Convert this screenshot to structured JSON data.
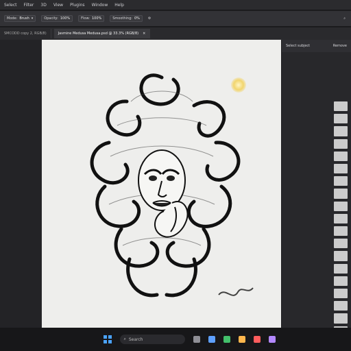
{
  "menu": [
    "Select",
    "Filter",
    "3D",
    "View",
    "Plugins",
    "Window",
    "Help"
  ],
  "options": {
    "mode_label": "Mode:",
    "mode_value": "Brush",
    "opacity_label": "Opacity:",
    "opacity_value": "100%",
    "flow_label": "Flow:",
    "flow_value": "100%",
    "smoothing_label": "Smoothing:",
    "smoothing_value": "0%"
  },
  "tabs": [
    {
      "label": "SMCODD copy 2, RGB/8)"
    },
    {
      "label": "Jasmine Medusa Medusa.psd @ 33.3% (RGB/8)"
    }
  ],
  "panel": {
    "title": "Select subject",
    "button": "Remove"
  },
  "taskbar": {
    "search_placeholder": "Search"
  },
  "colors": {
    "ui_dark": "#1b1b1d",
    "toolbar": "#323236",
    "accent_blue": "#4aa3ff",
    "doc": "#eeeeec",
    "ink": "#111111"
  }
}
